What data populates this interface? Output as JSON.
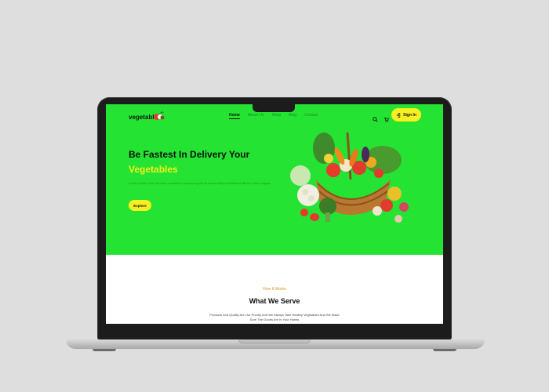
{
  "header": {
    "logo_text": "vegetable",
    "nav": [
      "Home",
      "About Us",
      "Shop",
      "Blog",
      "Contact"
    ],
    "signin_label": "Sign In"
  },
  "hero": {
    "title_line1": "Be Fastest In Delivery Your",
    "title_line2": "Vegetables",
    "description": "Lorem ipsum dolor sit amet consectetur adipiscing elit eiusmod tempor incididunt labore dolore magna",
    "cta_label": "Explore"
  },
  "section": {
    "eyebrow": "How It Works",
    "title": "What We Serve",
    "subtitle": "Products And Quality Are Our Priority And We Always Take Healthy Vegetables And We Make Sure The Goods Are In Your Hands"
  },
  "colors": {
    "hero_bg": "#25e332",
    "accent_yellow": "#f8ef22",
    "eyebrow": "#d4931a"
  }
}
